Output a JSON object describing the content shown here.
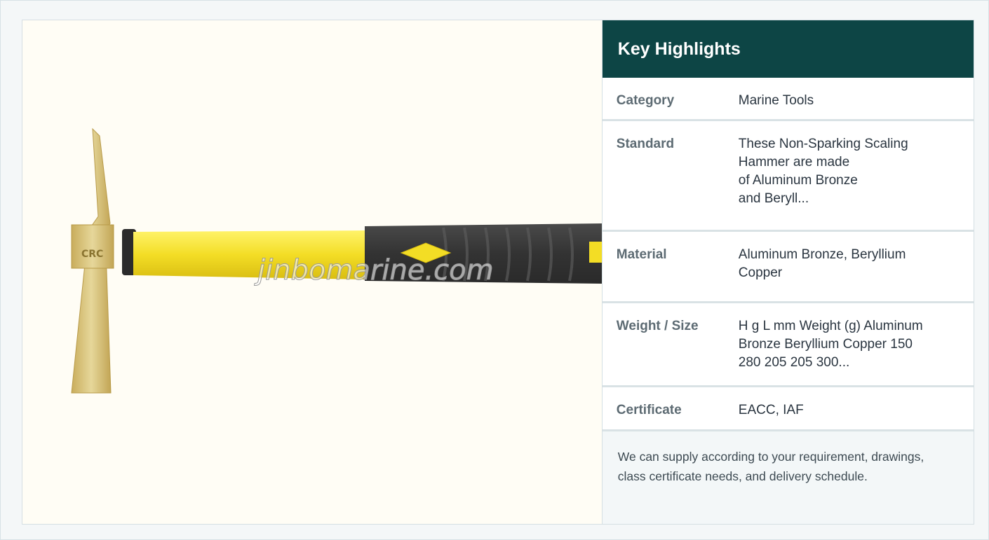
{
  "product_image": {
    "alt": "Non-Sparking Scaling Hammer",
    "watermark": "jinbomarine.com"
  },
  "highlights": {
    "title": "Key Highlights",
    "rows": [
      {
        "label": "Category",
        "value": "Marine Tools"
      },
      {
        "label": "Standard",
        "value": "These Non-Sparking Scaling\nHammer are made\nof Aluminum Bronze\nand Beryll..."
      },
      {
        "label": "Material",
        "value": "Aluminum Bronze, Beryllium\nCopper"
      },
      {
        "label": "Weight / Size",
        "value": "H g L mm Weight (g) Aluminum\nBronze Beryllium Copper 150\n280 205 205 300..."
      },
      {
        "label": "Certificate",
        "value": "EACC, IAF"
      }
    ],
    "note": "We can supply according to your requirement, drawings, class certificate needs, and delivery schedule."
  },
  "colors": {
    "header_bg": "#0d4545",
    "handle_yellow": "#f5e332",
    "grip_dark": "#3a3a3a",
    "head_gold": "#d7c27a"
  }
}
